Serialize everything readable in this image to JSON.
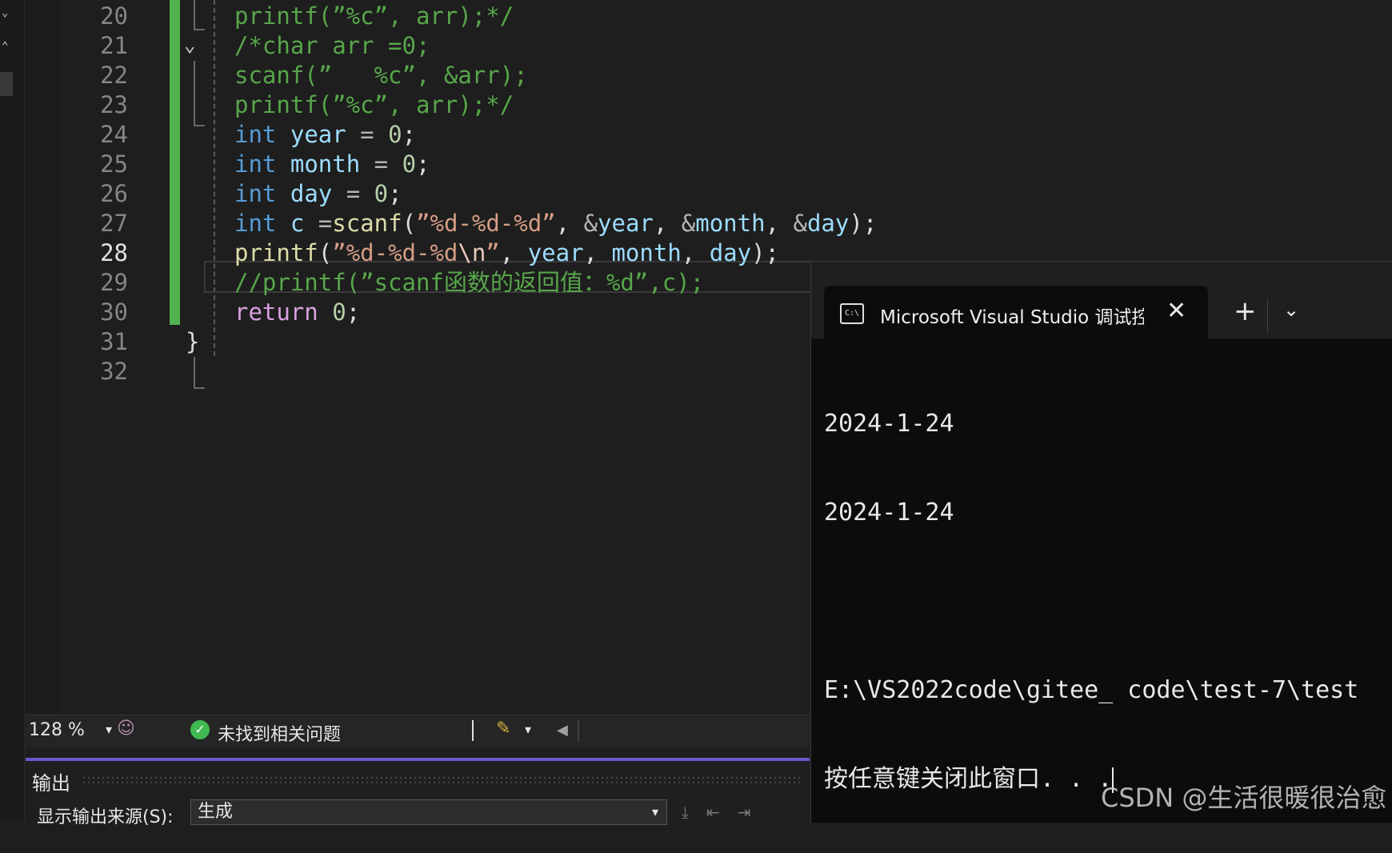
{
  "editor": {
    "lines": [
      {
        "num": "20",
        "tokens": [
          {
            "t": "printf(”%c”, arr);*/",
            "c": "c-com"
          }
        ]
      },
      {
        "num": "21",
        "tokens": [
          {
            "t": "/*char arr =0;",
            "c": "c-com"
          }
        ]
      },
      {
        "num": "22",
        "tokens": [
          {
            "t": "scanf(”   %c”, &arr);",
            "c": "c-com"
          }
        ]
      },
      {
        "num": "23",
        "tokens": [
          {
            "t": "printf(”%c”, arr);*/",
            "c": "c-com"
          }
        ]
      },
      {
        "num": "24",
        "tokens": [
          {
            "t": "int",
            "c": "c-kw"
          },
          {
            "t": " ",
            "c": "c-pl"
          },
          {
            "t": "year",
            "c": "c-var"
          },
          {
            "t": " = ",
            "c": "c-op"
          },
          {
            "t": "0",
            "c": "c-num"
          },
          {
            "t": ";",
            "c": "c-pl"
          }
        ]
      },
      {
        "num": "25",
        "tokens": [
          {
            "t": "int",
            "c": "c-kw"
          },
          {
            "t": " ",
            "c": "c-pl"
          },
          {
            "t": "month",
            "c": "c-var"
          },
          {
            "t": " = ",
            "c": "c-op"
          },
          {
            "t": "0",
            "c": "c-num"
          },
          {
            "t": ";",
            "c": "c-pl"
          }
        ]
      },
      {
        "num": "26",
        "tokens": [
          {
            "t": "int",
            "c": "c-kw"
          },
          {
            "t": " ",
            "c": "c-pl"
          },
          {
            "t": "day",
            "c": "c-var"
          },
          {
            "t": " = ",
            "c": "c-op"
          },
          {
            "t": "0",
            "c": "c-num"
          },
          {
            "t": ";",
            "c": "c-pl"
          }
        ]
      },
      {
        "num": "27",
        "tokens": [
          {
            "t": "int",
            "c": "c-kw"
          },
          {
            "t": " ",
            "c": "c-pl"
          },
          {
            "t": "c",
            "c": "c-var"
          },
          {
            "t": " =",
            "c": "c-op"
          },
          {
            "t": "scanf",
            "c": "c-fn"
          },
          {
            "t": "(",
            "c": "c-pl"
          },
          {
            "t": "”%d-%d-%d”",
            "c": "c-str"
          },
          {
            "t": ", ",
            "c": "c-pl"
          },
          {
            "t": "&",
            "c": "c-op"
          },
          {
            "t": "year",
            "c": "c-var"
          },
          {
            "t": ", ",
            "c": "c-pl"
          },
          {
            "t": "&",
            "c": "c-op"
          },
          {
            "t": "month",
            "c": "c-var"
          },
          {
            "t": ", ",
            "c": "c-pl"
          },
          {
            "t": "&",
            "c": "c-op"
          },
          {
            "t": "day",
            "c": "c-var"
          },
          {
            "t": ");",
            "c": "c-pl"
          }
        ]
      },
      {
        "num": "28",
        "current": true,
        "tokens": [
          {
            "t": "printf",
            "c": "c-fn"
          },
          {
            "t": "(",
            "c": "c-pl"
          },
          {
            "t": "”%d-%d-%d",
            "c": "c-str"
          },
          {
            "t": "\\n",
            "c": "c-esc"
          },
          {
            "t": "”",
            "c": "c-str"
          },
          {
            "t": ", ",
            "c": "c-pl"
          },
          {
            "t": "year",
            "c": "c-var"
          },
          {
            "t": ", ",
            "c": "c-pl"
          },
          {
            "t": "month",
            "c": "c-var"
          },
          {
            "t": ", ",
            "c": "c-pl"
          },
          {
            "t": "day",
            "c": "c-var"
          },
          {
            "t": ");",
            "c": "c-pl"
          }
        ]
      },
      {
        "num": "29",
        "tokens": [
          {
            "t": "//printf(”scanf函数的返回值：%d”,c);",
            "c": "c-com"
          }
        ]
      },
      {
        "num": "30",
        "tokens": [
          {
            "t": "return",
            "c": "c-ret"
          },
          {
            "t": " ",
            "c": "c-pl"
          },
          {
            "t": "0",
            "c": "c-num"
          },
          {
            "t": ";",
            "c": "c-pl"
          }
        ]
      },
      {
        "num": "31",
        "indent": "brace",
        "tokens": [
          {
            "t": "}",
            "c": "c-pl"
          }
        ]
      },
      {
        "num": "32",
        "tokens": []
      }
    ]
  },
  "statusbar": {
    "zoom": "128 %",
    "issues": "未找到相关问题"
  },
  "output": {
    "title": "输出",
    "source_label": "显示输出来源(S):",
    "source_value": "生成"
  },
  "terminal": {
    "tab_title": "Microsoft Visual Studio 调试控制台",
    "icon_text": "C:\\",
    "lines": [
      "2024-1-24",
      "2024-1-24",
      "",
      "E:\\VS2022code\\gitee_ code\\test-7\\test",
      "按任意键关闭此窗口. . ."
    ]
  },
  "watermark": "CSDN @生活很暖很治愈",
  "colors": {
    "accent_bar": "#4fb34f",
    "output_accent": "#6a5acd"
  }
}
